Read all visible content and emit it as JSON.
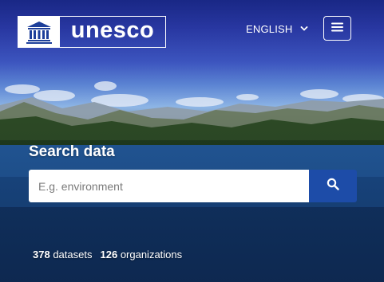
{
  "header": {
    "logo_text": "unesco",
    "language": "ENGLISH"
  },
  "search": {
    "title": "Search data",
    "placeholder": "E.g. environment"
  },
  "stats": {
    "datasets_count": "378",
    "datasets_label": "datasets",
    "organizations_count": "126",
    "organizations_label": "organizations"
  },
  "icons": {
    "logo": "unesco-temple-icon",
    "language": "chevron-down-icon",
    "menu": "hamburger-menu-icon",
    "search": "search-icon"
  },
  "colors": {
    "search_button": "#1d4ca8",
    "text": "#ffffff"
  }
}
